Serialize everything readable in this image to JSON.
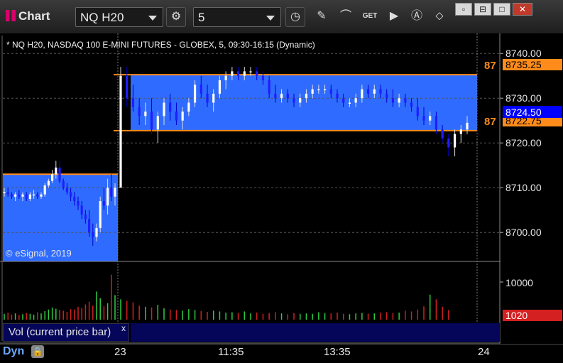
{
  "toolbar": {
    "app_title": "Chart",
    "symbol": "NQ H20",
    "interval": "5",
    "icons": [
      "settings-icon",
      "clock-icon",
      "pencil-icon",
      "study-icon",
      "get-icon",
      "play-icon",
      "annotation-icon",
      "link-icon"
    ],
    "get_label": "GET"
  },
  "window_buttons": {
    "restore": "▫",
    "minimize": "⊟",
    "maximize": "□",
    "close": "✕"
  },
  "chart": {
    "header": "* NQ H20, NASDAQ 100 E-MINI FUTURES - GLOBEX, 5, 09:30-16:15 (Dynamic)",
    "watermark": "© eSignal, 2019",
    "price_ticks": [
      "8740.00",
      "8730.00",
      "8720.00",
      "8710.00",
      "8700.00"
    ],
    "last_price": "8724.50",
    "level_upper": "8735.25",
    "level_lower": "8722.75",
    "level_label_upper": "87",
    "level_label_lower": "87",
    "vol_tick": "10000",
    "vol_last": "1020",
    "vol_study_label": "Vol (current price bar)",
    "vol_close": "x",
    "x_ticks": [
      "23",
      "11:35",
      "13:35",
      "24"
    ],
    "dyn_label": "Dyn",
    "colors": {
      "up": "#ffffff",
      "down": "#1e1eff",
      "box": "#2f6bff",
      "level": "#ff8c1a",
      "last": "#0000ff",
      "vol_up": "#2ecc40",
      "vol_down": "#d42020"
    }
  },
  "chart_data": {
    "type": "candlestick",
    "title": "* NQ H20, NASDAQ 100 E-MINI FUTURES - GLOBEX, 5, 09:30-16:15 (Dynamic)",
    "ylim": [
      8694,
      8744
    ],
    "y_ticks": [
      8740,
      8730,
      8720,
      8710,
      8700
    ],
    "last": 8724.5,
    "levels": [
      8735.25,
      8722.75,
      8713.0
    ],
    "candles": [
      [
        8709,
        8710,
        8708,
        8709
      ],
      [
        8709,
        8710,
        8708,
        8708.5
      ],
      [
        8708.5,
        8709,
        8707.5,
        8708
      ],
      [
        8708,
        8709,
        8707,
        8708.5
      ],
      [
        8708.5,
        8709.5,
        8707.5,
        8708
      ],
      [
        8708,
        8709,
        8707,
        8708.5
      ],
      [
        8708.5,
        8709,
        8707,
        8707.5
      ],
      [
        8707.5,
        8709,
        8707,
        8708.5
      ],
      [
        8708.5,
        8709.5,
        8707.5,
        8708.5
      ],
      [
        8708.5,
        8709,
        8707.5,
        8708
      ],
      [
        8708,
        8709,
        8707.5,
        8708.5
      ],
      [
        8708.5,
        8711,
        8708,
        8710.5
      ],
      [
        8710.5,
        8712,
        8710,
        8711.5
      ],
      [
        8711.5,
        8714,
        8711,
        8713
      ],
      [
        8713,
        8716,
        8712,
        8714.5
      ],
      [
        8714.5,
        8716,
        8711,
        8711.5
      ],
      [
        8711.5,
        8712,
        8709.5,
        8710
      ],
      [
        8710,
        8711,
        8708.5,
        8709
      ],
      [
        8709,
        8710,
        8707,
        8708
      ],
      [
        8708,
        8709,
        8706,
        8707
      ],
      [
        8707,
        8708,
        8705,
        8706
      ],
      [
        8706,
        8707,
        8703,
        8704
      ],
      [
        8704,
        8705,
        8702,
        8703
      ],
      [
        8703,
        8705,
        8699,
        8700
      ],
      [
        8700,
        8702,
        8697,
        8699
      ],
      [
        8699,
        8702,
        8698,
        8701
      ],
      [
        8701,
        8708,
        8700,
        8707
      ],
      [
        8707,
        8710,
        8705,
        8706
      ],
      [
        8706,
        8712,
        8704,
        8710
      ],
      [
        8710,
        8713,
        8707,
        8708
      ],
      [
        8708,
        8711,
        8706,
        8710
      ],
      [
        8710,
        8737,
        8710,
        8735
      ],
      [
        8735,
        8737,
        8728,
        8730
      ],
      [
        8730,
        8733,
        8727,
        8728
      ],
      [
        8728,
        8730,
        8724,
        8726
      ],
      [
        8726,
        8729,
        8724,
        8727
      ],
      [
        8727,
        8730,
        8722,
        8723
      ],
      [
        8723,
        8727,
        8720,
        8726
      ],
      [
        8726,
        8730,
        8724,
        8729
      ],
      [
        8729,
        8731,
        8725,
        8727
      ],
      [
        8727,
        8729,
        8724,
        8725
      ],
      [
        8725,
        8728,
        8723,
        8727
      ],
      [
        8727,
        8730,
        8726,
        8729
      ],
      [
        8729,
        8734,
        8728,
        8733
      ],
      [
        8733,
        8735,
        8730,
        8731
      ],
      [
        8731,
        8733,
        8728,
        8729
      ],
      [
        8729,
        8732,
        8727,
        8731
      ],
      [
        8731,
        8735,
        8730,
        8734
      ],
      [
        8734,
        8736,
        8732,
        8735
      ],
      [
        8735,
        8737,
        8734,
        8736
      ],
      [
        8736,
        8737,
        8734,
        8735
      ],
      [
        8735,
        8737,
        8734,
        8736
      ],
      [
        8736,
        8737,
        8735,
        8736
      ],
      [
        8736,
        8737,
        8734,
        8735
      ],
      [
        8735,
        8736,
        8733,
        8734
      ],
      [
        8734,
        8735,
        8730,
        8731
      ],
      [
        8731,
        8733,
        8729,
        8730
      ],
      [
        8730,
        8732,
        8729,
        8731
      ],
      [
        8731,
        8732,
        8729,
        8730
      ],
      [
        8730,
        8731,
        8728,
        8729
      ],
      [
        8729,
        8731,
        8728,
        8730
      ],
      [
        8730,
        8732,
        8729,
        8731
      ],
      [
        8731,
        8733,
        8730,
        8732
      ],
      [
        8732,
        8733,
        8731,
        8732
      ],
      [
        8732,
        8733,
        8731,
        8732
      ],
      [
        8732,
        8733,
        8730,
        8731
      ],
      [
        8731,
        8732,
        8729,
        8730
      ],
      [
        8730,
        8731,
        8728,
        8729
      ],
      [
        8729,
        8730,
        8728,
        8729
      ],
      [
        8729,
        8731,
        8728,
        8730
      ],
      [
        8730,
        8733,
        8729,
        8732
      ],
      [
        8732,
        8733,
        8730,
        8731
      ],
      [
        8731,
        8733,
        8730,
        8732
      ],
      [
        8732,
        8733,
        8730,
        8731
      ],
      [
        8731,
        8732,
        8729,
        8730
      ],
      [
        8730,
        8732,
        8728,
        8729
      ],
      [
        8729,
        8731,
        8728,
        8730
      ],
      [
        8730,
        8731,
        8728,
        8729
      ],
      [
        8729,
        8730,
        8727,
        8728
      ],
      [
        8728,
        8730,
        8725,
        8726
      ],
      [
        8726,
        8728,
        8724,
        8725
      ],
      [
        8725,
        8727,
        8724,
        8726
      ],
      [
        8726,
        8727,
        8722,
        8723
      ],
      [
        8723,
        8724,
        8720,
        8721
      ],
      [
        8721,
        8722,
        8717,
        8719
      ],
      [
        8719,
        8723,
        8717,
        8722
      ],
      [
        8722,
        8724,
        8720,
        8723
      ],
      [
        8723,
        8726,
        8722,
        8724.5
      ]
    ],
    "volume": [
      1500,
      1800,
      1300,
      1600,
      1200,
      1400,
      1700,
      1500,
      1300,
      1900,
      1600,
      2200,
      2600,
      3100,
      2800,
      2500,
      2300,
      2000,
      2700,
      2600,
      3300,
      3000,
      3900,
      4600,
      3600,
      7200,
      5500,
      3400,
      4200,
      11500,
      6300,
      5200,
      4800,
      4400,
      3600,
      3300,
      3100,
      3800,
      2900,
      2600,
      2500,
      2300,
      2700,
      2500,
      2200,
      2000,
      2300,
      2100,
      1800,
      1900,
      1700,
      2100,
      1600,
      1800,
      1500,
      1700,
      1900,
      1600,
      1400,
      1700,
      1500,
      1600,
      1500,
      1900,
      1700,
      1600,
      1800,
      1500,
      1400,
      1600,
      1700,
      1500,
      1600,
      1800,
      1900,
      1700,
      1800,
      2300,
      2100,
      2600,
      3400,
      6400,
      5200,
      3300,
      2500
    ]
  }
}
